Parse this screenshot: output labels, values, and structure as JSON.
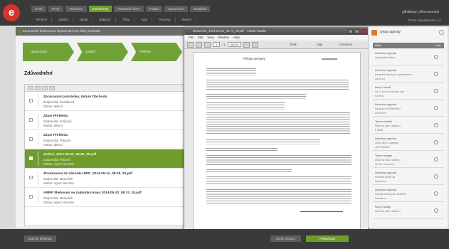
{
  "app": {
    "logo_letter": "e"
  },
  "nav": {
    "tabs_top": [
      {
        "label": "Úvod",
        "active": false
      },
      {
        "label": "Firmy",
        "active": false
      },
      {
        "label": "Archivace",
        "active": false
      },
      {
        "label": "Dokumenty",
        "active": true
      },
      {
        "label": "Nastavení firmy",
        "active": false
      },
      {
        "label": "Podpis",
        "active": false
      },
      {
        "label": "Zpracování",
        "active": false
      },
      {
        "label": "Workflow",
        "active": false
      }
    ],
    "tabs_sub": [
      "Termíny",
      "Zadání",
      "Úkoly",
      "Šablony",
      "Třídy",
      "Typy",
      "Procesy",
      "Report"
    ]
  },
  "user": {
    "line1": "přihlášený: Jiřina Novotná",
    "line2": "Firma: Společnost s.r.o."
  },
  "workspace": {
    "title": "Zpracování dokumentu: Zpracování pro účely obchodu",
    "steps": [
      "Zpracování",
      "Zadání",
      "Přehled",
      "Kontrola"
    ],
    "section_title": "Zdůvodnění",
    "rows": [
      {
        "title": "Zpracování poznámky, datum Obchodu",
        "l2": "Zodpovídá: Dvořáková",
        "l3": "Status: aktivní",
        "selected": false
      },
      {
        "title": "Zápis Přehledu",
        "l2": "Zodpovídá: Krejčová",
        "l3": "Status: aktivní",
        "selected": false
      },
      {
        "title": "Zápis Přehledu",
        "l2": "Zodpovídá: Pokorný",
        "l3": "Status: aktivní",
        "selected": false
      },
      {
        "title": "Zadání_2014-08-05_08.28_25.pdf",
        "l2": "Zodpovídá: Pokorná",
        "l3": "Status: Agent Novotná",
        "selected": true
      },
      {
        "title": "Zhodnocení do záhonku RPP_2014-05-12_08.28_25.pdf",
        "l2": "Zodpovídá: Matoušek",
        "l3": "Status: Agent Novotná",
        "selected": false
      },
      {
        "title": "ARRP Sledování ve zaáhonku kopu 2014-05-22_08.74_25.pdf",
        "l2": "Zodpovídá: Matoušek",
        "l3": "Status: Agent Novotná",
        "selected": false
      }
    ]
  },
  "viewer": {
    "title": "Document_2014-05-22_08.74_25.pdf – Adobe Reader",
    "menu": [
      "File",
      "Edit",
      "View",
      "Window",
      "Help"
    ],
    "page_field": "1",
    "page_total": "/ 1",
    "zoom": "66.0%",
    "links": [
      "Tools",
      "Sign",
      "Comment"
    ],
    "doc_heading": "Příloha smlouvy"
  },
  "right_panel": {
    "title": "Úkoly agendy",
    "col_left": "Úkol",
    "col_right": "Stav",
    "items": [
      {
        "t1": "Uzavřená agenda",
        "t2": "na jednání přímo",
        "t3": ""
      },
      {
        "t1": "Uzavřená agenda",
        "t2": "Uzavřete smlouvu s partnerem",
        "t3": "na 2014"
      },
      {
        "t1": "Nový 2 úkolů",
        "t2": "na 1 úkol z pověření vás",
        "t3": "na trhu"
      },
      {
        "t1": "Uzavřená agenda",
        "t2": "Na práci na Přehledu",
        "t3": "do konce"
      },
      {
        "t1": "Termín dodání",
        "t2": "Úkol na vás z odboru",
        "t3": "k lhůtě"
      },
      {
        "t1": "Uzavřená agenda",
        "t2": "Nový úkol z agendy",
        "t3": "na Přehledu"
      },
      {
        "t1": "Termín dodání",
        "t2": "Úkol na vás z odboru",
        "t3": "do 15. červenec"
      },
      {
        "t1": "Uzavřená agenda",
        "t2": "Přehled úkolů za",
        "t3": "do konce"
      },
      {
        "t1": "Uzavřená agenda",
        "t2": "Rozpis úkolů pro oddělení",
        "t3": "uzavřeno"
      },
      {
        "t1": "Nový 2 úkoly",
        "t2": "Úkol na vás z odboru",
        "t3": ""
      },
      {
        "t1": "Uzavřená agenda",
        "t2": "Přehled úkolů do zpracování",
        "t3": "na trhu"
      }
    ]
  },
  "bottom": {
    "left_button": "Zpět do přehledu",
    "mid_button": "Uložit záznam",
    "right_button": "Pokračovat"
  }
}
